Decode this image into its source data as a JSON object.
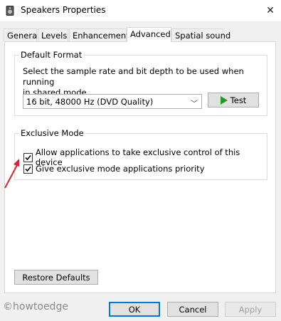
{
  "window": {
    "title": "Speakers Properties"
  },
  "icons": {
    "app": "speaker-icon",
    "close": "close-icon",
    "play": "play-icon",
    "check": "checkmark-icon"
  },
  "tabs": [
    {
      "label": "General"
    },
    {
      "label": "Levels"
    },
    {
      "label": "Enhancements"
    },
    {
      "label": "Advanced"
    },
    {
      "label": "Spatial sound"
    }
  ],
  "active_tab": "Advanced",
  "default_format": {
    "legend": "Default Format",
    "description_line1": "Select the sample rate and bit depth to be used when running",
    "description_line2": "in shared mode.",
    "selected_format": "16 bit, 48000 Hz (DVD Quality)",
    "test_label": "Test"
  },
  "exclusive_mode": {
    "legend": "Exclusive Mode",
    "allow_exclusive_label": "Allow applications to take exclusive control of this device",
    "allow_exclusive_checked": true,
    "priority_label": "Give exclusive mode applications priority",
    "priority_checked": true
  },
  "restore_label": "Restore Defaults",
  "footer": {
    "ok_label": "OK",
    "cancel_label": "Cancel",
    "apply_label": "Apply"
  },
  "watermark": "©howtoedge",
  "colors": {
    "accent": "#0078d7",
    "annotation_arrow": "#e0202a",
    "play": "#1f9d2a"
  }
}
